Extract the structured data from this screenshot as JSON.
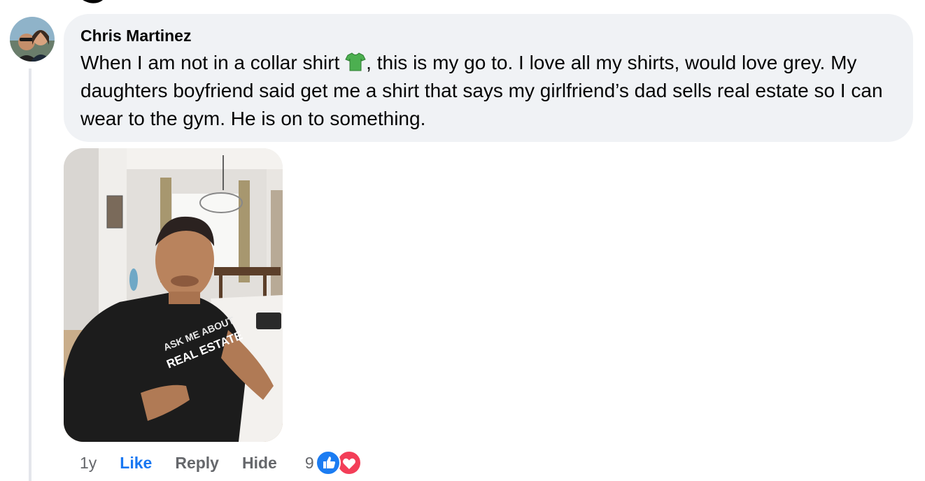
{
  "comment": {
    "author": "Chris Martinez",
    "text_before_icon": "When I am not in a collar shirt ",
    "text_after_icon": ", this is my go to. I love all my shirts, would love grey. My daughters boyfriend said get me a shirt that says my girlfriend’s dad sells real estate so I can wear to the gym. He is on to something.",
    "inline_icon": "green-t-shirt-emoji"
  },
  "photo": {
    "shirt_line1": "ASK ME ABOUT",
    "shirt_line2": "REAL ESTATE"
  },
  "actions": {
    "time": "1y",
    "like_label": "Like",
    "reply_label": "Reply",
    "hide_label": "Hide",
    "reaction_count": "9",
    "reactions": [
      "like-icon",
      "love-icon"
    ]
  },
  "colors": {
    "bubble": "#f0f2f5",
    "like_active": "#1877f2",
    "meta_text": "#65676b",
    "like_reaction": "#1b7cf2",
    "love_reaction": "#f33e58"
  }
}
